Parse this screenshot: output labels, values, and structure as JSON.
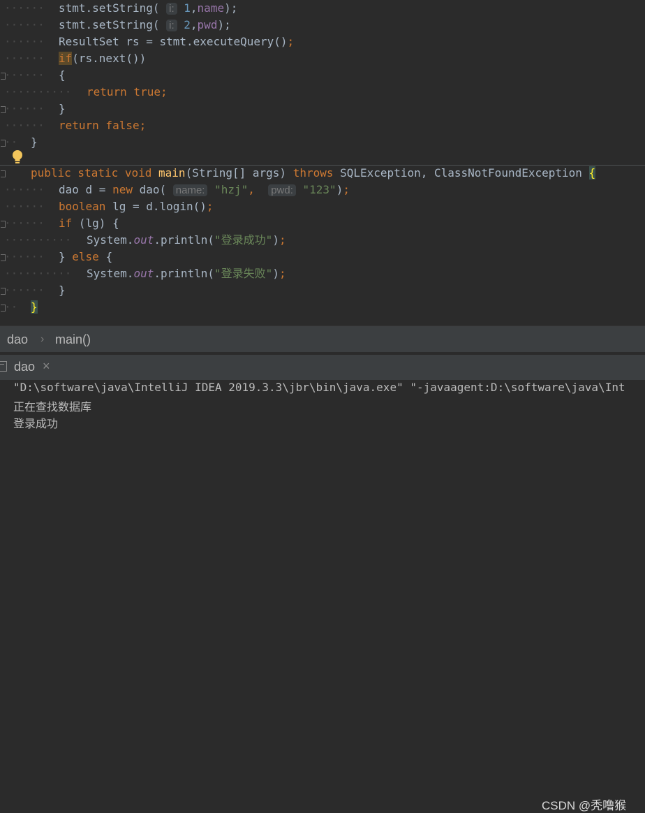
{
  "editor": {
    "lines": [
      {
        "seg": [
          {
            "t": "stmt.setString( "
          },
          {
            "h": "i:"
          },
          {
            "t": " "
          },
          {
            "n": "1"
          },
          {
            "t": ","
          },
          {
            "f": "name"
          },
          {
            "t": ");"
          }
        ]
      },
      {
        "seg": [
          {
            "t": "stmt.setString( "
          },
          {
            "h": "i:"
          },
          {
            "t": " "
          },
          {
            "n": "2"
          },
          {
            "t": ","
          },
          {
            "f": "pwd"
          },
          {
            "t": ");"
          }
        ]
      },
      {
        "seg": [
          {
            "t": "ResultSet rs = stmt.executeQuery()"
          },
          {
            "k": ";"
          }
        ]
      },
      {
        "seg": [
          {
            "ifh": "if"
          },
          {
            "t": "(rs.next())"
          }
        ]
      },
      {
        "seg": [
          {
            "t": "{"
          }
        ]
      },
      {
        "seg": [
          {
            "k": "return true;"
          }
        ]
      },
      {
        "seg": [
          {
            "t": "}"
          }
        ]
      },
      {
        "seg": [
          {
            "k": "return false;"
          }
        ]
      },
      {
        "seg": [
          {
            "t": "}"
          }
        ]
      },
      {
        "seg": [
          {
            "k": "public static void "
          },
          {
            "fn": "main"
          },
          {
            "t": "(String[] args) "
          },
          {
            "k": "throws "
          },
          {
            "t": "SQLException, ClassNotFoundException "
          },
          {
            "bh": "{"
          }
        ]
      },
      {
        "seg": [
          {
            "t": "dao d = "
          },
          {
            "k": "new "
          },
          {
            "t": "dao( "
          },
          {
            "h": "name:"
          },
          {
            "t": " "
          },
          {
            "s": "\"hzj\""
          },
          {
            "k": ", "
          },
          {
            "t": " "
          },
          {
            "h": "pwd:"
          },
          {
            "t": " "
          },
          {
            "s": "\"123\""
          },
          {
            "t": ")"
          },
          {
            "k": ";"
          }
        ]
      },
      {
        "seg": [
          {
            "k": "boolean "
          },
          {
            "t": "lg = d.login()"
          },
          {
            "k": ";"
          }
        ]
      },
      {
        "seg": [
          {
            "k": "if "
          },
          {
            "t": "(lg) {"
          }
        ]
      },
      {
        "seg": [
          {
            "t": "System."
          },
          {
            "i": "out"
          },
          {
            "t": ".println("
          },
          {
            "s": "\"登录成功\""
          },
          {
            "t": ")"
          },
          {
            "k": ";"
          }
        ]
      },
      {
        "seg": [
          {
            "t": "} "
          },
          {
            "k": "else "
          },
          {
            "t": "{"
          }
        ]
      },
      {
        "seg": [
          {
            "t": "System."
          },
          {
            "i": "out"
          },
          {
            "t": ".println("
          },
          {
            "s": "\"登录失败\""
          },
          {
            "t": ")"
          },
          {
            "k": ";"
          }
        ]
      },
      {
        "seg": [
          {
            "t": "}"
          }
        ]
      },
      {
        "seg": [
          {
            "bh": "}"
          }
        ]
      }
    ]
  },
  "breadcrumb": {
    "class_name": "dao",
    "separator": "›",
    "method": "main()"
  },
  "run_tab": {
    "label": "dao",
    "close": "×"
  },
  "console": {
    "lines": [
      "\"D:\\software\\java\\IntelliJ IDEA 2019.3.3\\jbr\\bin\\java.exe\" \"-javaagent:D:\\software\\java\\Int",
      "正在查找数据库",
      "登录成功"
    ]
  },
  "watermark": "CSDN @秃噜猴",
  "colors": {
    "background": "#2b2b2b",
    "keyword": "#cc7832",
    "string": "#6a8759",
    "field": "#9876aa",
    "function": "#ffc66d"
  },
  "icons": [
    "lightbulb-icon",
    "console-icon",
    "close-icon",
    "chevron-right-icon"
  ]
}
